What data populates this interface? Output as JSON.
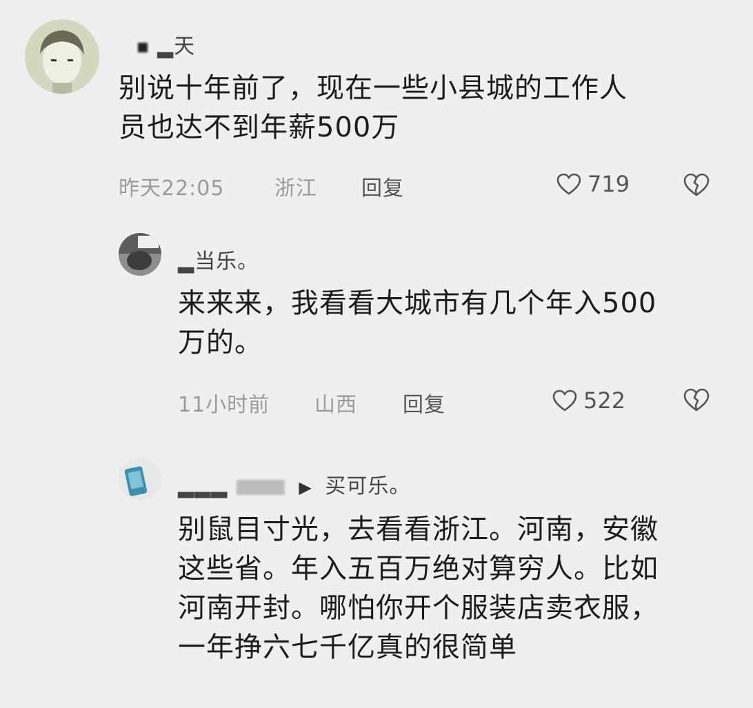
{
  "comments": [
    {
      "author": "▂天",
      "text_lines": [
        "别说十年前了，现在一些小县城的工作人",
        "员也达不到年薪500万"
      ],
      "time": "昨天22:05",
      "location": "浙江",
      "reply_label": "回复",
      "likes": "719"
    },
    {
      "author": "▂当乐。",
      "text_lines": [
        "来来来，我看看大城市有几个年入500",
        "万的。"
      ],
      "time": "11小时前",
      "location": "山西",
      "reply_label": "回复",
      "likes": "522"
    },
    {
      "author": "▂▂▂",
      "reply_to": "买可乐。",
      "text_lines": [
        "别鼠目寸光，去看看浙江。河南，安徽",
        "这些省。年入五百万绝对算穷人。比如",
        "河南开封。哪怕你开个服装店卖衣服，",
        "一年挣六七千亿真的很简单"
      ]
    }
  ]
}
